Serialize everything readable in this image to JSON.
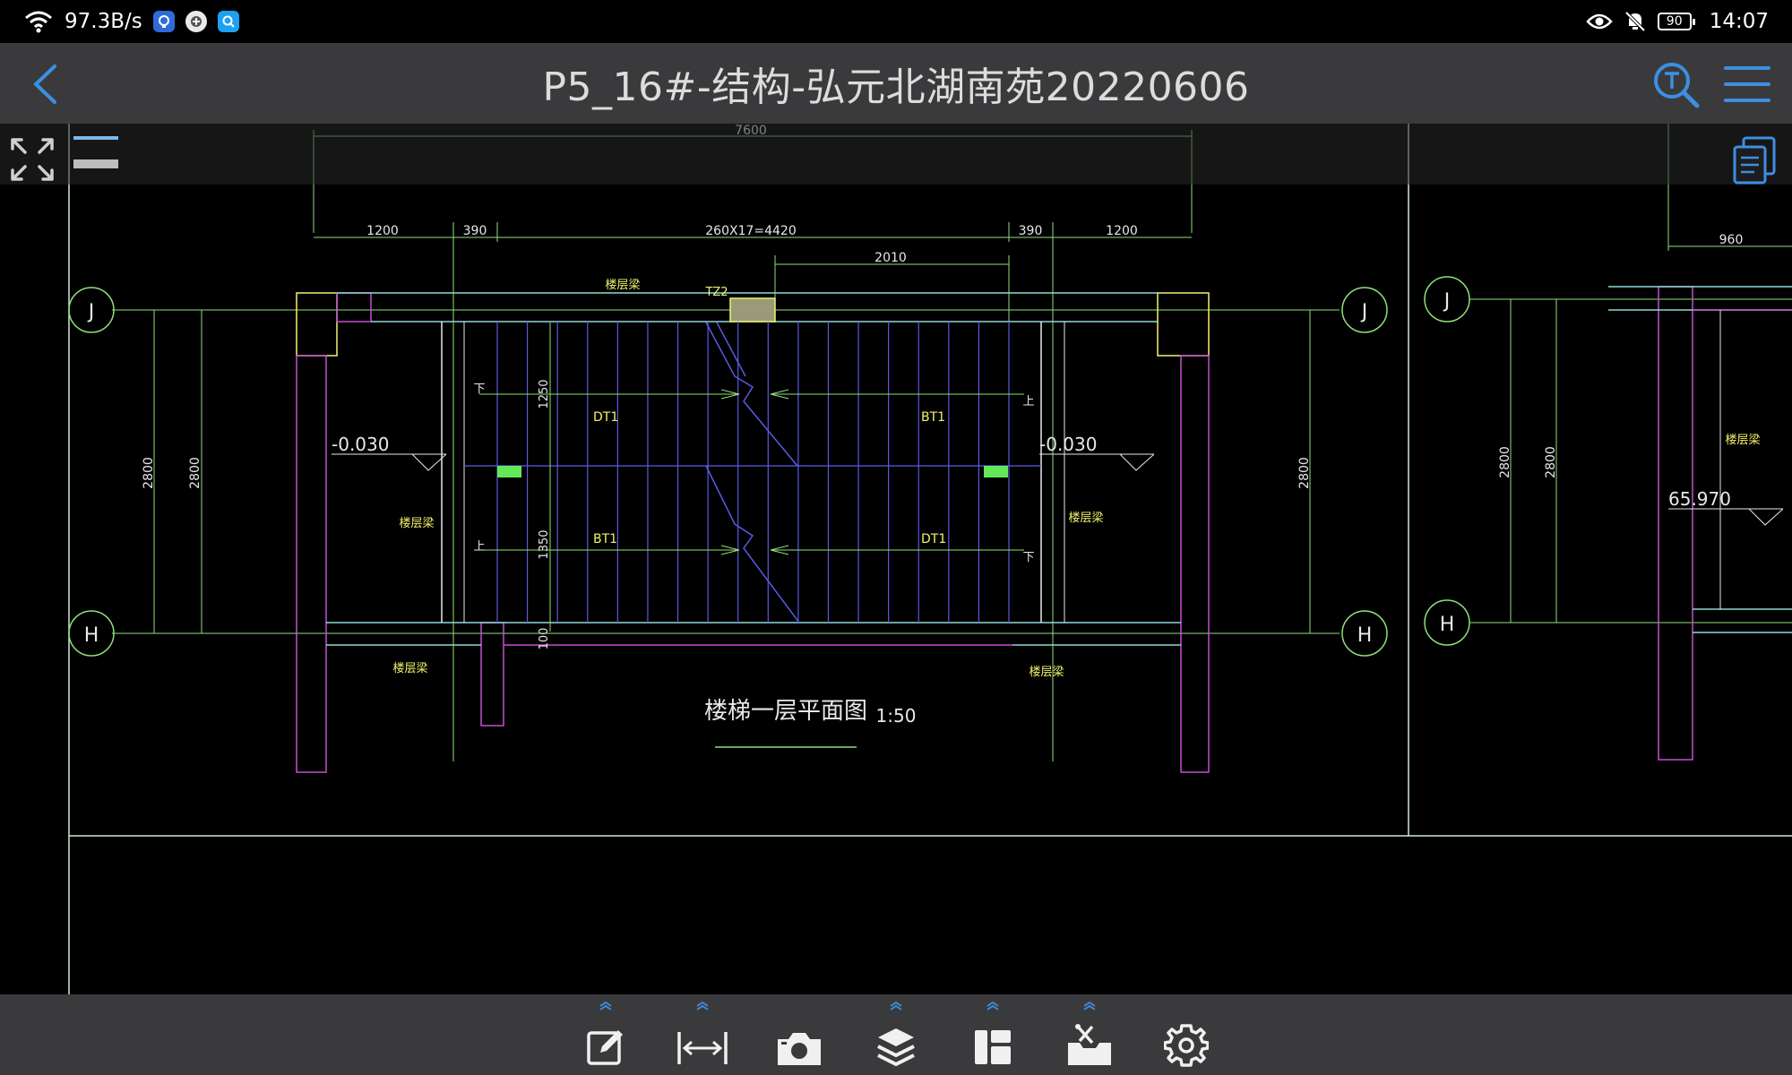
{
  "status": {
    "signal": "⁶",
    "speed": "97.3B/s",
    "time": "14:07",
    "battery": "90"
  },
  "titlebar": {
    "title": "P5_16#-结构-弘元北湖南苑20220606"
  },
  "drawing": {
    "dims": {
      "total": "7600",
      "left_1200": "1200",
      "left_390": "390",
      "treads": "260X17=4420",
      "right_390": "390",
      "right_1200": "1200",
      "mid_2010": "2010",
      "left_2800a": "2800",
      "left_2800b": "2800",
      "right_2800": "2800",
      "v_1250": "1250",
      "v_1350": "1350",
      "v_100": "100",
      "r2_960": "960",
      "r2_2800a": "2800",
      "r2_2800b": "2800"
    },
    "axes": {
      "j": "J",
      "h": "H"
    },
    "labels": {
      "tz2": "TZ2",
      "level_left": "-0.030",
      "level_right": "-0.030",
      "level_r2": "65.970",
      "dt1_a": "DT1",
      "bt1_a": "BT1",
      "bt1_b": "BT1",
      "dt1_b": "DT1",
      "beam1": "楼层梁",
      "beam2": "楼层梁",
      "beam3": "楼层梁",
      "beam4": "楼层梁",
      "beam5": "楼层梁",
      "beam6": "楼层梁",
      "up1": "上",
      "up2": "上",
      "down1": "下",
      "down2": "下",
      "plan_title": "楼梯一层平面图",
      "scale": "1:50"
    }
  },
  "colors": {
    "accent": "#3d8fe0",
    "bar": "#3a3a3c",
    "cad_green": "#8ee07a",
    "cad_blue": "#5a5ae6",
    "cad_magenta": "#c44fd0",
    "cad_yellow": "#f2f26a",
    "cad_white": "#e8e8e8"
  },
  "toolbar": {
    "tools": [
      {
        "name": "annotate",
        "icon": "edit-note-icon"
      },
      {
        "name": "measure",
        "icon": "measure-distance-icon"
      },
      {
        "name": "camera",
        "icon": "camera-icon"
      },
      {
        "name": "layers",
        "icon": "layers-icon"
      },
      {
        "name": "layout",
        "icon": "layout-icon"
      },
      {
        "name": "tools",
        "icon": "toolbox-icon"
      },
      {
        "name": "settings",
        "icon": "gear-icon"
      }
    ]
  }
}
